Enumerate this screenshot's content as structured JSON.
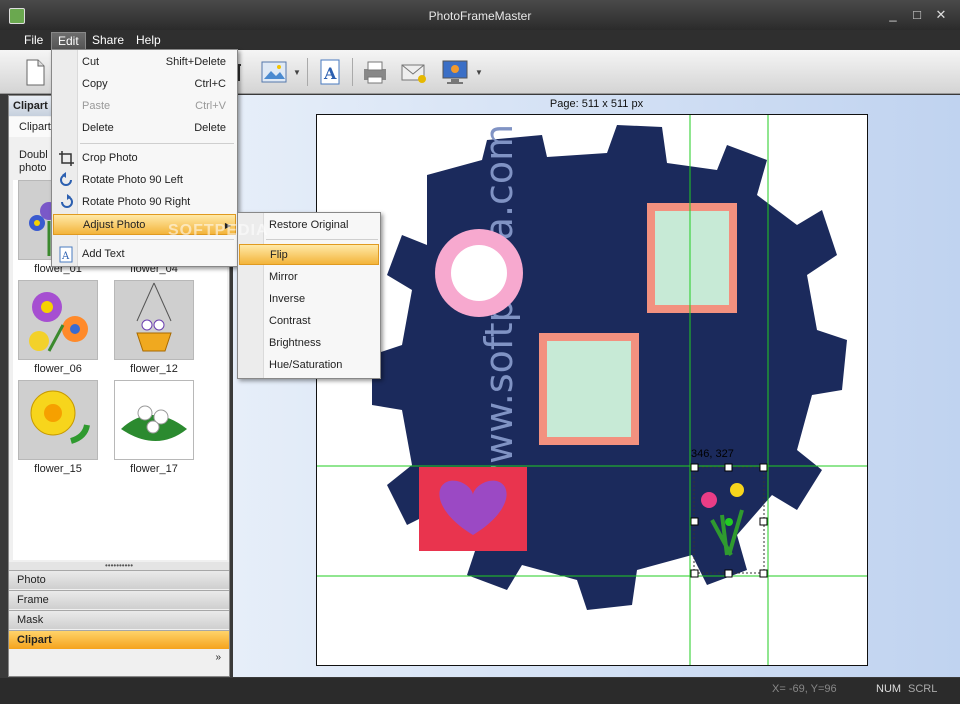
{
  "window": {
    "title": "PhotoFrameMaster",
    "minimize": "_",
    "maximize": "□",
    "close": "✕"
  },
  "menubar": {
    "file": "File",
    "edit": "Edit",
    "share": "Share",
    "help": "Help"
  },
  "edit_menu": {
    "items": [
      {
        "label": "Cut",
        "shortcut": "Shift+Delete"
      },
      {
        "label": "Copy",
        "shortcut": "Ctrl+C"
      },
      {
        "label": "Paste",
        "shortcut": "Ctrl+V"
      },
      {
        "label": "Delete",
        "shortcut": "Delete"
      },
      {
        "label": "Crop Photo",
        "shortcut": ""
      },
      {
        "label": "Rotate Photo 90 Left",
        "shortcut": ""
      },
      {
        "label": "Rotate Photo 90 Right",
        "shortcut": ""
      },
      {
        "label": "Adjust Photo",
        "shortcut": ""
      },
      {
        "label": "Add Text",
        "shortcut": ""
      }
    ]
  },
  "adjust_submenu": {
    "items": [
      "Restore Original",
      "Flip",
      "Mirror",
      "Inverse",
      "Contrast",
      "Brightness",
      "Hue/Saturation"
    ]
  },
  "leftpanel": {
    "header": "Clipart",
    "tab": "Clipart",
    "hint_line1": "Doubl",
    "hint_line2": "photo",
    "thumbnails": [
      {
        "caption": "flower_01"
      },
      {
        "caption": "flower_04"
      },
      {
        "caption": "flower_06"
      },
      {
        "caption": "flower_12"
      },
      {
        "caption": "flower_15"
      },
      {
        "caption": "flower_17"
      }
    ],
    "grip": "••••••••••",
    "sections": [
      "Photo",
      "Frame",
      "Mask",
      "Clipart"
    ],
    "more": "»"
  },
  "workarea": {
    "page_label": "Page: 511 x 511 px",
    "selection_coords": "346, 327"
  },
  "watermark": "SOFTPEDIA",
  "statusbar": {
    "coords": "X= -69, Y=96",
    "num": "NUM",
    "scrl": "SCRL"
  },
  "colors": {
    "accent": "#f5a31d",
    "highlight": "#ffe9a8",
    "gear": "#1b2a5c",
    "guide": "#22cc22"
  }
}
